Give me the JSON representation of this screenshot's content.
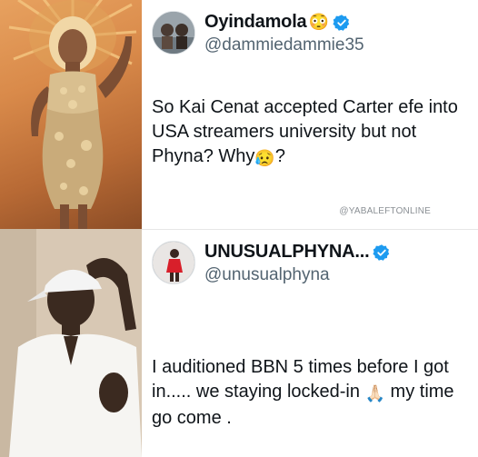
{
  "tweet1": {
    "display_name": "Oyindamola",
    "name_emoji": "😳",
    "handle": "@dammiedammie35",
    "text_before": "So Kai Cenat accepted Carter efe into USA streamers university but not Phyna? Why",
    "text_emoji": "😥",
    "text_after": "?",
    "watermark": "@YABALEFTONLINE"
  },
  "tweet2": {
    "display_name": "UNUSUALPHYNA...",
    "handle": "@unusualphyna",
    "text_before": "I auditioned BBN 5 times before I got in..... we staying locked-in",
    "text_emoji": "🙏🏻",
    "text_after": "my time go come ."
  },
  "colors": {
    "verified": "#1d9bf0",
    "handle": "#536471",
    "text": "#0f1419"
  },
  "icons": {
    "verified": "verified-badge-icon",
    "photo_top": "woman-gold-gown-photo",
    "photo_bottom": "man-white-cap-photo"
  }
}
